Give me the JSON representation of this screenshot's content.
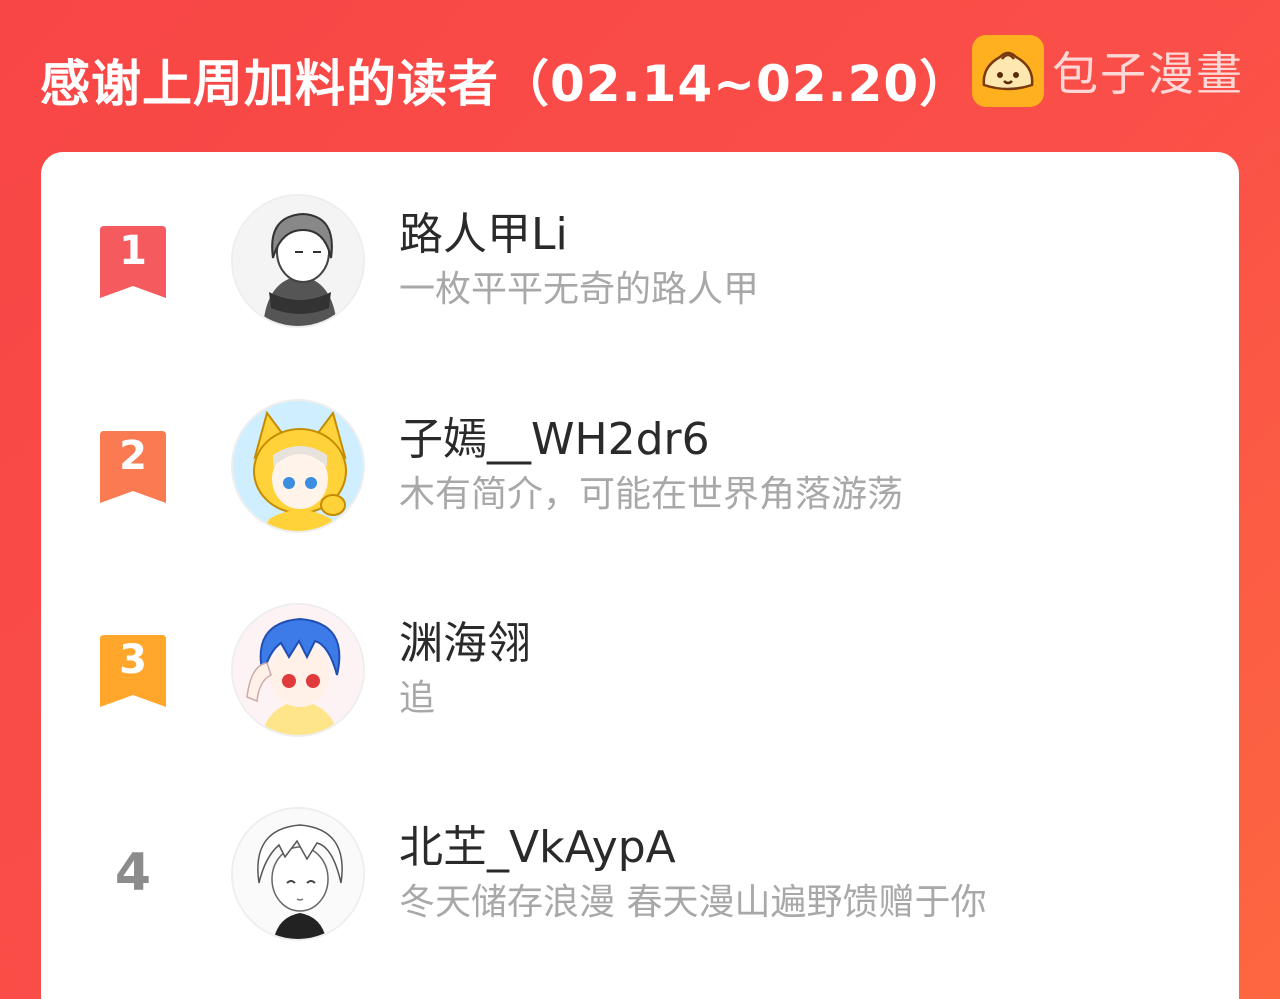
{
  "header": {
    "title": "感谢上周加料的读者（02.14~02.20）",
    "brand_name": "包子漫畫",
    "brand_logo_icon": "bun-icon"
  },
  "colors": {
    "background": "#f84646",
    "rank_1": "#f55a5e",
    "rank_2": "#fa7a52",
    "rank_3": "#ffa62b",
    "rank_plain": "#8c8c8c"
  },
  "readers": [
    {
      "rank": "1",
      "name": "路人甲Li",
      "bio": "一枚平平无奇的路人甲",
      "avatar_icon": "manga-girl-scarf-avatar"
    },
    {
      "rank": "2",
      "name": "子嫣__WH2dr6",
      "bio": "木有简介，可能在世界角落游荡",
      "avatar_icon": "fox-hood-girl-avatar"
    },
    {
      "rank": "3",
      "name": "渊海翎",
      "bio": "追",
      "avatar_icon": "blue-hair-boy-avatar"
    },
    {
      "rank": "4",
      "name": "北芏_VkAypA",
      "bio": "冬天储存浪漫 春天漫山遍野馈赠于你",
      "avatar_icon": "sketch-boy-avatar"
    }
  ]
}
